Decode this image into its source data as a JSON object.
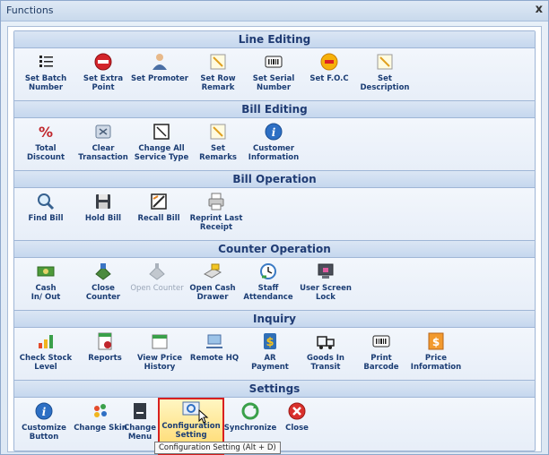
{
  "window": {
    "title": "Functions",
    "close_label": "x"
  },
  "sections": [
    {
      "title": "Line Editing",
      "items": [
        {
          "label": "Set Batch\nNumber",
          "icon": "batch-list-icon"
        },
        {
          "label": "Set Extra\nPoint",
          "icon": "point-badge-icon"
        },
        {
          "label": "Set Promoter",
          "icon": "promoter-person-icon"
        },
        {
          "label": "Set Row\nRemark",
          "icon": "note-icon"
        },
        {
          "label": "Set Serial\nNumber",
          "icon": "barcode-icon"
        },
        {
          "label": "Set F.O.C",
          "icon": "free-badge-icon"
        },
        {
          "label": "Set\nDescription",
          "icon": "note-icon"
        }
      ]
    },
    {
      "title": "Bill Editing",
      "items": [
        {
          "label": "Total\nDiscount",
          "icon": "percent-icon"
        },
        {
          "label": "Clear\nTransaction",
          "icon": "clear-icon"
        },
        {
          "label": "Change All\nService Type",
          "icon": "service-type-icon"
        },
        {
          "label": "Set\nRemarks",
          "icon": "note-icon"
        },
        {
          "label": "Customer\nInformation",
          "icon": "info-icon"
        }
      ]
    },
    {
      "title": "Bill Operation",
      "items": [
        {
          "label": "Find Bill",
          "icon": "magnifier-icon"
        },
        {
          "label": "Hold Bill",
          "icon": "floppy-disk-icon"
        },
        {
          "label": "Recall Bill",
          "icon": "recall-icon"
        },
        {
          "label": "Reprint Last\nReceipt",
          "icon": "printer-icon"
        }
      ]
    },
    {
      "title": "Counter Operation",
      "items": [
        {
          "label": "Cash\nIn/ Out",
          "icon": "cash-icon"
        },
        {
          "label": "Close\nCounter",
          "icon": "close-counter-icon"
        },
        {
          "label": "Open Counter",
          "icon": "open-counter-icon",
          "disabled": true
        },
        {
          "label": "Open Cash\nDrawer",
          "icon": "cash-drawer-icon"
        },
        {
          "label": "Staff\nAttendance",
          "icon": "clock-icon"
        },
        {
          "label": "User Screen\nLock",
          "icon": "screen-lock-icon"
        }
      ]
    },
    {
      "title": "Inquiry",
      "items": [
        {
          "label": "Check Stock\nLevel",
          "icon": "bar-chart-icon"
        },
        {
          "label": "Reports",
          "icon": "report-icon"
        },
        {
          "label": "View Price\nHistory",
          "icon": "calendar-icon"
        },
        {
          "label": "Remote HQ",
          "icon": "remote-icon"
        },
        {
          "label": "AR\nPayment",
          "icon": "dollar-icon"
        },
        {
          "label": "Goods In\nTransit",
          "icon": "transit-icon"
        },
        {
          "label": "Print\nBarcode",
          "icon": "barcode-icon"
        },
        {
          "label": "Price\nInformation",
          "icon": "price-tag-icon"
        }
      ]
    },
    {
      "title": "Settings",
      "items": [
        {
          "label": "Customize\nButton",
          "icon": "info-icon"
        },
        {
          "label": "Change Skin",
          "icon": "paint-icon"
        },
        {
          "label": "Change\nMenu",
          "icon": "menu-book-icon"
        },
        {
          "label": "Configuration\nSetting",
          "icon": "config-icon",
          "selected": true
        },
        {
          "label": "Synchronize",
          "icon": "sync-icon"
        },
        {
          "label": "Close",
          "icon": "close-circle-icon"
        }
      ]
    }
  ],
  "tooltip": "Configuration Setting (Alt + D)",
  "colors": {
    "header_text": "#1f3b73",
    "label_text": "#1b3d74",
    "selected_outline": "#d82020",
    "selected_fill": "#ffd86a"
  }
}
